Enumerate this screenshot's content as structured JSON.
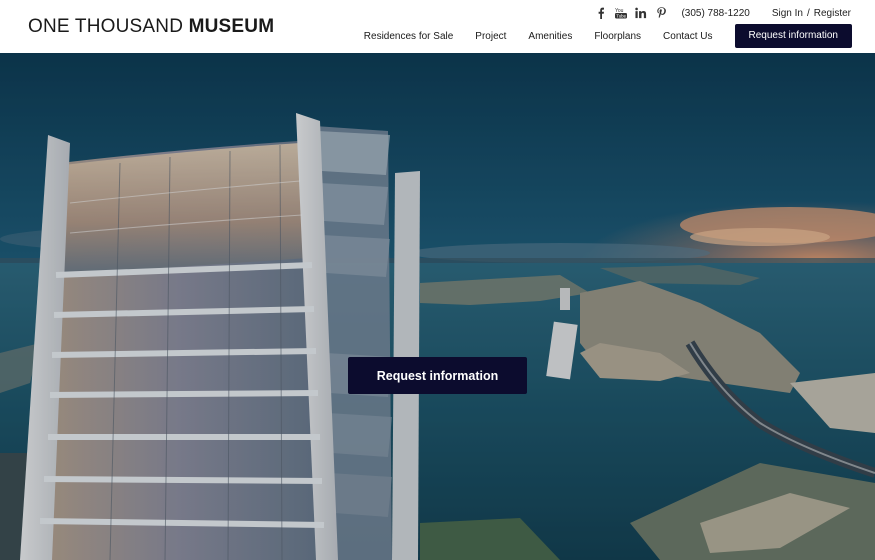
{
  "brand": {
    "logo_light": "ONE THOUSAND ",
    "logo_bold": "MUSEUM"
  },
  "topbar": {
    "social_icons": [
      "facebook-icon",
      "youtube-icon",
      "linkedin-icon",
      "pinterest-icon"
    ],
    "phone": "(305) 788-1220",
    "sign_in": "Sign In",
    "separator": "/",
    "register": "Register"
  },
  "nav": {
    "items": [
      {
        "label": "Residences for Sale"
      },
      {
        "label": "Project"
      },
      {
        "label": "Amenities"
      },
      {
        "label": "Floorplans"
      },
      {
        "label": "Contact Us"
      }
    ],
    "cta_label": "Request information"
  },
  "hero": {
    "cta_label": "Request information"
  },
  "colors": {
    "cta_bg": "#0c0c2e",
    "header_bg": "#ffffff",
    "text_dark": "#1a1a1a"
  }
}
